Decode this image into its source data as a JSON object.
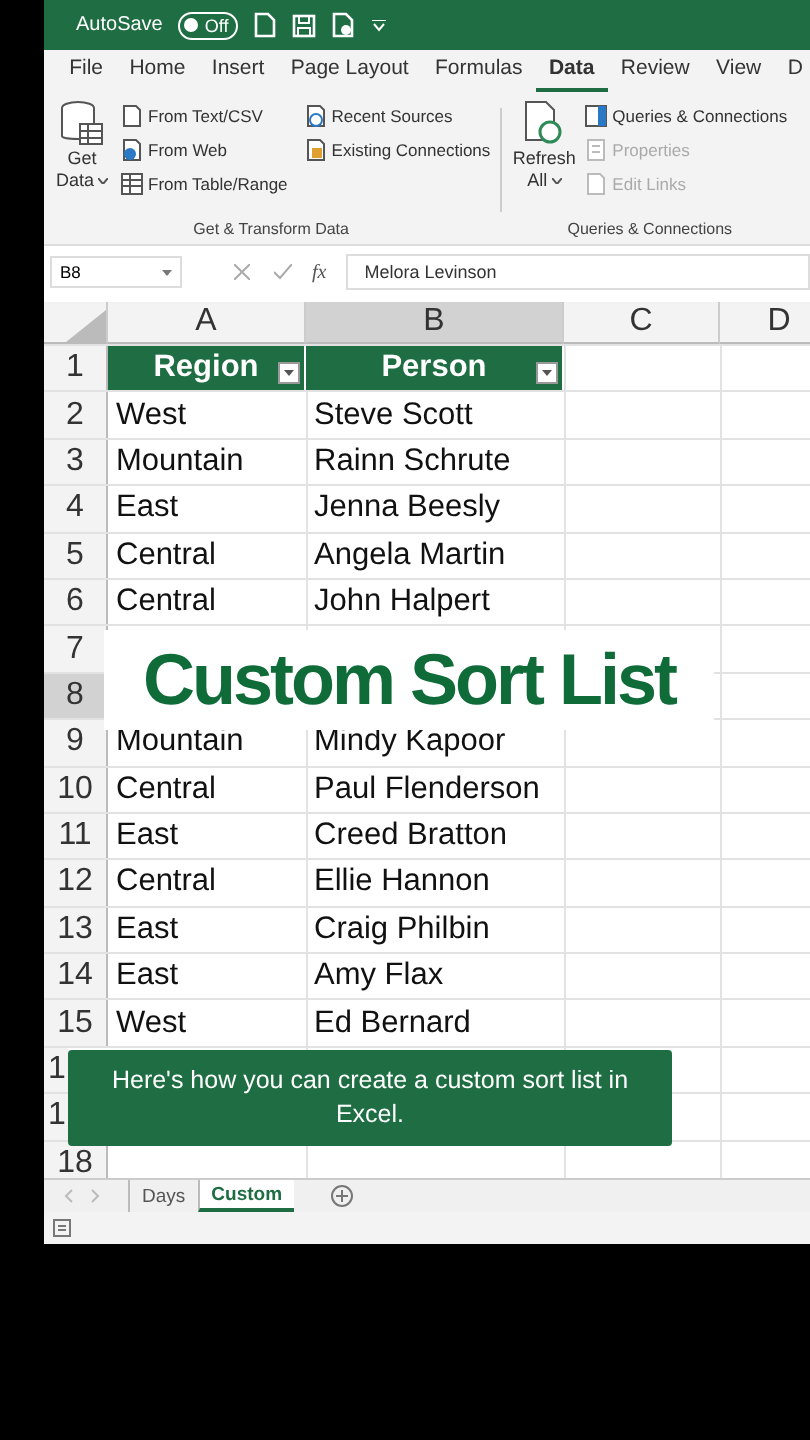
{
  "title_bar": {
    "autosave_label": "AutoSave",
    "autosave": {
      "on": false,
      "label": "Off"
    }
  },
  "ribbon_tabs": [
    {
      "label": "File",
      "selected": false
    },
    {
      "label": "Home",
      "selected": false
    },
    {
      "label": "Insert",
      "selected": false
    },
    {
      "label": "Page Layout",
      "selected": false
    },
    {
      "label": "Formulas",
      "selected": false
    },
    {
      "label": "Data",
      "selected": true
    },
    {
      "label": "Review",
      "selected": false
    },
    {
      "label": "View",
      "selected": false
    },
    {
      "label": "D",
      "selected": false
    }
  ],
  "ribbon": {
    "get_data": {
      "line_1": "Get",
      "line_2": "Data"
    },
    "source_buttons": [
      {
        "label": "From Text/CSV",
        "kind": "file"
      },
      {
        "label": "From Web",
        "kind": "web"
      },
      {
        "label": "From Table/Range",
        "kind": "table"
      }
    ],
    "connection_buttons": [
      {
        "label": "Recent Sources",
        "kind": "recent"
      },
      {
        "label": "Existing Connections",
        "kind": "existing"
      }
    ],
    "group_1": "Get & Transform Data",
    "refresh": {
      "line_1": "Refresh",
      "line_2": "All"
    },
    "query_buttons": [
      {
        "label": "Queries & Connections",
        "kind": "queries",
        "disabled": false
      },
      {
        "label": "Properties",
        "kind": "properties",
        "disabled": true
      },
      {
        "label": "Edit Links",
        "kind": "links",
        "disabled": true
      }
    ],
    "group_2": "Queries & Connections"
  },
  "formula_bar": {
    "name_box": "B8",
    "function_label": "fx",
    "value": "Melora Levinson"
  },
  "columns": [
    {
      "label": "A",
      "selected": false
    },
    {
      "label": "B",
      "selected": true
    },
    {
      "label": "C",
      "selected": false
    },
    {
      "label": "D",
      "selected": false
    }
  ],
  "header_row": {
    "number": "1",
    "cells": [
      "Region",
      "Person"
    ]
  },
  "rows": [
    {
      "number": "2",
      "region": "West",
      "person": "Steve Scott",
      "selected": false,
      "kind": "normal"
    },
    {
      "number": "3",
      "region": "Mountain",
      "person": "Rainn Schrute",
      "selected": false,
      "kind": "normal"
    },
    {
      "number": "4",
      "region": "East",
      "person": "Jenna Beesly",
      "selected": false,
      "kind": "normal"
    },
    {
      "number": "5",
      "region": "Central",
      "person": "Angela Martin",
      "selected": false,
      "kind": "normal"
    },
    {
      "number": "6",
      "region": "Central",
      "person": "John Halpert",
      "selected": false,
      "kind": "normal"
    },
    {
      "number": "7",
      "selected": false,
      "kind": "normal"
    },
    {
      "number": "8",
      "selected": true,
      "kind": "normal"
    },
    {
      "number": "9",
      "region": "Mountain",
      "person": "Mindy Kapoor",
      "selected": false,
      "kind": "normal"
    },
    {
      "number": "10",
      "region": "Central",
      "person": "Paul Flenderson",
      "selected": false,
      "kind": "normal"
    },
    {
      "number": "11",
      "region": "East",
      "person": "Creed Bratton",
      "selected": false,
      "kind": "normal"
    },
    {
      "number": "12",
      "region": "Central",
      "person": "Ellie Hannon",
      "selected": false,
      "kind": "normal"
    },
    {
      "number": "13",
      "region": "East",
      "person": "Craig Philbin",
      "selected": false,
      "kind": "normal"
    },
    {
      "number": "14",
      "region": "East",
      "person": "Amy Flax",
      "selected": false,
      "kind": "normal"
    },
    {
      "number": "15",
      "region": "West",
      "person": "Ed Bernard",
      "selected": false,
      "kind": "normal"
    },
    {
      "number": "1",
      "selected": false,
      "kind": "covered"
    },
    {
      "number": "1",
      "selected": false,
      "kind": "covered"
    },
    {
      "number": "18",
      "selected": false,
      "kind": "normal"
    }
  ],
  "banner": "Custom Sort List",
  "caption": "Here's how you can create a custom sort list in Excel.",
  "sheet_tabs": [
    {
      "label": "Days",
      "selected": false
    },
    {
      "label": "Custom",
      "selected": true
    }
  ]
}
